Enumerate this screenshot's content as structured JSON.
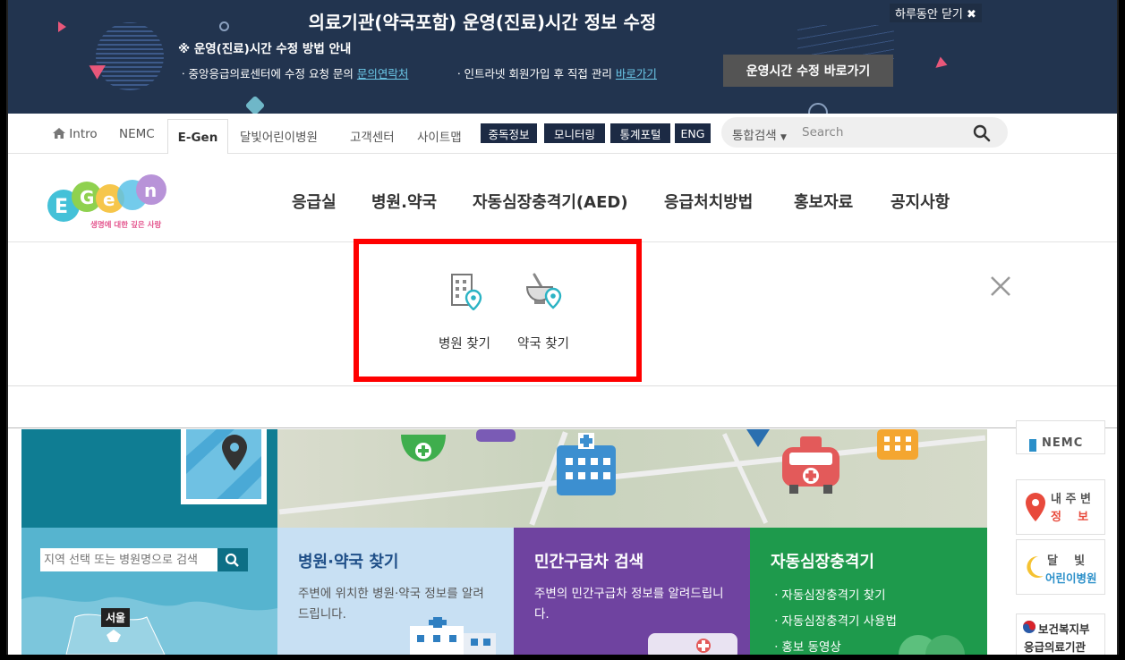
{
  "notice": {
    "title": "의료기관(약국포함) 운영(진료)시간 정보 수정",
    "subtitle": "※ 운영(진료)시간 수정 방법 안내",
    "line1_prefix": "ㆍ중앙응급의료센터에 수정 요청 문의",
    "line1_link": "문의연락처",
    "line2_prefix": "ㆍ인트라넷 회원가입 후 직접 관리",
    "line2_link": "바로가기",
    "button": "운영시간 수정 바로가기",
    "close_today": "하루동안 닫기"
  },
  "util": {
    "intro": "Intro",
    "nemc": "NEMC",
    "egen": "E-Gen",
    "moon": "달빛어린이병원",
    "cs": "고객센터",
    "sitemap": "사이트맵",
    "buttons": [
      "중독정보",
      "모니터링",
      "통계포털",
      "ENG"
    ],
    "search_scope": "통합검색",
    "search_placeholder": "Search"
  },
  "logo": {
    "tagline": "생명에 대한 깊은 사랑"
  },
  "gnb": [
    "응급실",
    "병원.약국",
    "자동심장충격기(AED)",
    "응급처치방법",
    "홍보자료",
    "공지사항"
  ],
  "dropdown": {
    "items": [
      {
        "label": "병원 찾기",
        "icon": "hospital-location-icon"
      },
      {
        "label": "약국 찾기",
        "icon": "pharmacy-mortar-icon"
      }
    ],
    "highlight_color": "#ff0000"
  },
  "content": {
    "region_placeholder": "지역 선택 또는 병원명으로 검색",
    "seoul_label": "서울",
    "hosp_tile": {
      "title": "병원·약국 찾기",
      "desc": "주변에 위치한 병원·약국 정보를 알려드립니다."
    },
    "amb_tile": {
      "title": "민간구급차 검색",
      "desc": "주변의 민간구급차 정보를 알려드립니다."
    },
    "aed_tile": {
      "title": "자동심장충격기",
      "items": [
        "ㆍ자동심장충격기 찾기",
        "ㆍ자동심장충격기 사용법",
        "ㆍ홍보 동영상"
      ]
    },
    "side": {
      "nemc": "NEMC",
      "near_top": "내 주 변",
      "near_bottom": "정    보",
      "moon_top": "달    빛",
      "moon_bottom": "어린이병원",
      "mohw_top": "보건복지부",
      "mohw_bottom": "응급의료기관"
    }
  },
  "colors": {
    "banner": "#22344f",
    "navy": "#1c2a44",
    "teal": "#0f7d93",
    "purple": "#6f43a0",
    "green": "#1e9a4c"
  }
}
